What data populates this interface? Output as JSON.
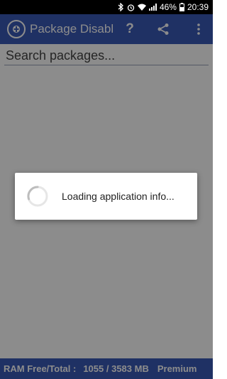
{
  "status_bar": {
    "battery": "46%",
    "time": "20:39",
    "icons": [
      "bluetooth-icon",
      "alarm-icon",
      "wifi-icon",
      "signal-icon",
      "battery-icon"
    ]
  },
  "app_bar": {
    "title": "Package Disabl...",
    "help_label": "?",
    "icons": [
      "app-logo-icon",
      "share-icon",
      "more-vert-icon"
    ],
    "color": "#3a59b6"
  },
  "search": {
    "placeholder": "Search packages..."
  },
  "footer": {
    "ram_label": "RAM Free/Total :",
    "ram_value": "1055 / 3583 MB",
    "tier": "Premium"
  },
  "dialog": {
    "message": "Loading application info..."
  }
}
